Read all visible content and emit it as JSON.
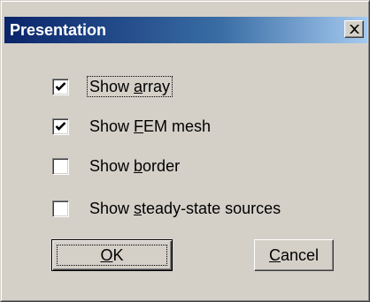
{
  "dialog": {
    "title": "Presentation",
    "close_symbol": "✕"
  },
  "options": [
    {
      "pre": "Show ",
      "access": "a",
      "post": "rray",
      "checked": true,
      "focused": true
    },
    {
      "pre": "Show ",
      "access": "F",
      "post": "EM mesh",
      "checked": true,
      "focused": false
    },
    {
      "pre": "Show ",
      "access": "b",
      "post": "order",
      "checked": false,
      "focused": false
    },
    {
      "pre": "Show ",
      "access": "s",
      "post": "teady-state sources",
      "checked": false,
      "focused": false
    }
  ],
  "buttons": {
    "ok": {
      "access": "O",
      "post": "K"
    },
    "cancel": {
      "access": "C",
      "post": "ancel"
    }
  },
  "icons": {
    "close": "close-icon",
    "check": "checkmark-icon"
  },
  "colors": {
    "titlebar_start": "#0a246a",
    "titlebar_end": "#a6caf0",
    "face": "#d4d0c8"
  }
}
